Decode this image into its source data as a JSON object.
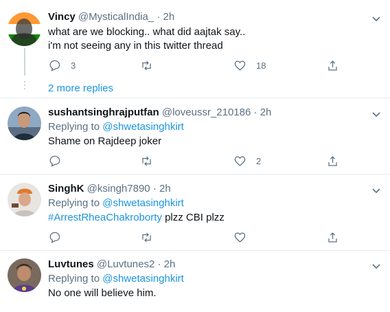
{
  "tweets": [
    {
      "name": "Vincy",
      "handle": "@MysticalIndia_",
      "dot": "·",
      "time": "2h",
      "lines": [
        "what are we blocking.. what did aajtak say..",
        "i'm not seeing any in this twitter thread"
      ],
      "reply_count": "3",
      "retweet_count": "",
      "like_count": "18"
    },
    {
      "name": "sushantsinghrajputfan",
      "handle": "@loveussr_210186",
      "dot": "·",
      "time": "2h",
      "replying_prefix": "Replying to",
      "replying_to": "@shwetasinghkirt",
      "text": "Shame on Rajdeep joker",
      "reply_count": "",
      "retweet_count": "",
      "like_count": "2"
    },
    {
      "name": "SinghK",
      "handle": "@ksingh7890",
      "dot": "·",
      "time": "2h",
      "replying_prefix": "Replying to",
      "replying_to": "@shwetasinghkirt",
      "hashtag": "#ArrestRheaChakroborty",
      "text_after": " plzz CBI plzz",
      "reply_count": "",
      "retweet_count": "",
      "like_count": ""
    },
    {
      "name": "Luvtunes",
      "handle": "@Luvtunes2",
      "dot": "·",
      "time": "2h",
      "replying_prefix": "Replying to",
      "replying_to": "@shwetasinghkirt",
      "text": "No one will believe him."
    }
  ],
  "more_replies": "2 more replies",
  "colors": {
    "link": "#1b95e0",
    "muted": "#5b7083",
    "divider": "#e6ecf0"
  },
  "icons": [
    "reply-icon",
    "retweet-icon",
    "like-icon",
    "share-icon",
    "caret-down-icon"
  ]
}
